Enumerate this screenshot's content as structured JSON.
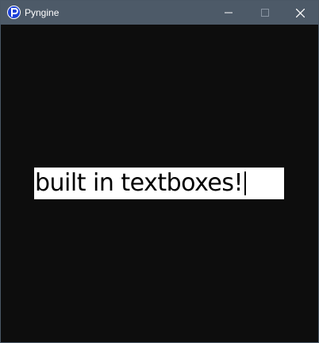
{
  "window": {
    "title": "Pyngine",
    "icon": "pyngine-logo-icon"
  },
  "titlebar_buttons": {
    "minimize": "minimize-icon",
    "maximize": "maximize-icon",
    "close": "close-icon"
  },
  "textbox": {
    "value": "built in textboxes!"
  },
  "colors": {
    "titlebar": "#4d5a68",
    "canvas": "#0d0d0d",
    "textbox_bg": "#ffffff",
    "text": "#000000"
  }
}
